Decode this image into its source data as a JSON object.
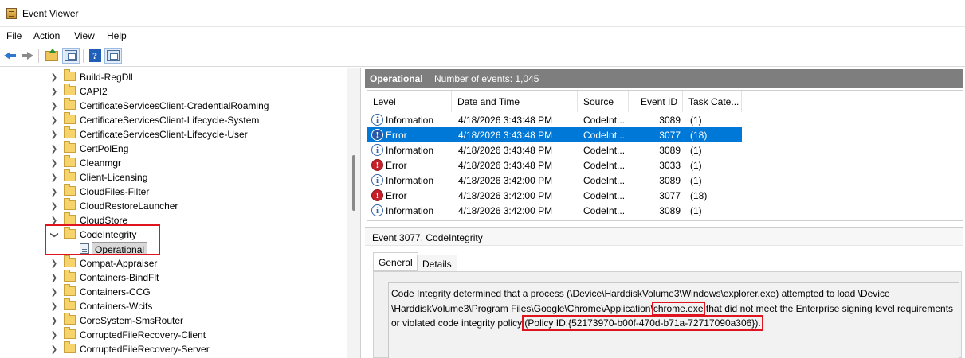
{
  "window": {
    "title": "Event Viewer"
  },
  "menu": [
    "File",
    "Action",
    "View",
    "Help"
  ],
  "toolbar": {
    "help_glyph": "?"
  },
  "tree": {
    "items": [
      "Build-RegDll",
      "CAPI2",
      "CertificateServicesClient-CredentialRoaming",
      "CertificateServicesClient-Lifecycle-System",
      "CertificateServicesClient-Lifecycle-User",
      "CertPolEng",
      "Cleanmgr",
      "Client-Licensing",
      "CloudFiles-Filter",
      "CloudRestoreLauncher",
      "CloudStore",
      "CodeIntegrity",
      "Compat-Appraiser",
      "Containers-BindFlt",
      "Containers-CCG",
      "Containers-Wcifs",
      "CoreSystem-SmsRouter",
      "CorruptedFileRecovery-Client",
      "CorruptedFileRecovery-Server"
    ],
    "selected_child": "Operational"
  },
  "log_header": {
    "name": "Operational",
    "count_text": "Number of events: 1,045"
  },
  "grid": {
    "columns": [
      "Level",
      "Date and Time",
      "Source",
      "Event ID",
      "Task Cate..."
    ],
    "rows": [
      {
        "level": "Information",
        "datetime": "4/18/2026 3:43:48 PM",
        "source": "CodeInt...",
        "event_id": "3089",
        "task": "(1)"
      },
      {
        "level": "Error",
        "datetime": "4/18/2026 3:43:48 PM",
        "source": "CodeInt...",
        "event_id": "3077",
        "task": "(18)"
      },
      {
        "level": "Information",
        "datetime": "4/18/2026 3:43:48 PM",
        "source": "CodeInt...",
        "event_id": "3089",
        "task": "(1)"
      },
      {
        "level": "Error",
        "datetime": "4/18/2026 3:43:48 PM",
        "source": "CodeInt...",
        "event_id": "3033",
        "task": "(1)"
      },
      {
        "level": "Information",
        "datetime": "4/18/2026 3:42:00 PM",
        "source": "CodeInt...",
        "event_id": "3089",
        "task": "(1)"
      },
      {
        "level": "Error",
        "datetime": "4/18/2026 3:42:00 PM",
        "source": "CodeInt...",
        "event_id": "3077",
        "task": "(18)"
      },
      {
        "level": "Information",
        "datetime": "4/18/2026 3:42:00 PM",
        "source": "CodeInt...",
        "event_id": "3089",
        "task": "(1)"
      }
    ]
  },
  "detail": {
    "title": "Event 3077, CodeIntegrity",
    "tab_general": "General",
    "tab_details": "Details",
    "msg_part1": "Code Integrity determined that a process (\\Device\\HarddiskVolume3\\Windows\\explorer.exe) attempted to load \\Device",
    "msg_part2a": "\\HarddiskVolume3\\Program Files\\Google\\Chrome\\Application\\",
    "msg_highlight1": "chrome.exe",
    "msg_part2b": " that did not meet the Enterprise signing level requirements",
    "msg_part3a": "or violated code integrity policy ",
    "msg_highlight2": "(Policy ID:{52173970-b00f-470d-b71a-72717090a306})."
  },
  "colors": {
    "accent": "#0078d7",
    "highlight_border": "#e0141e",
    "header_gray": "#7e7e7e"
  }
}
